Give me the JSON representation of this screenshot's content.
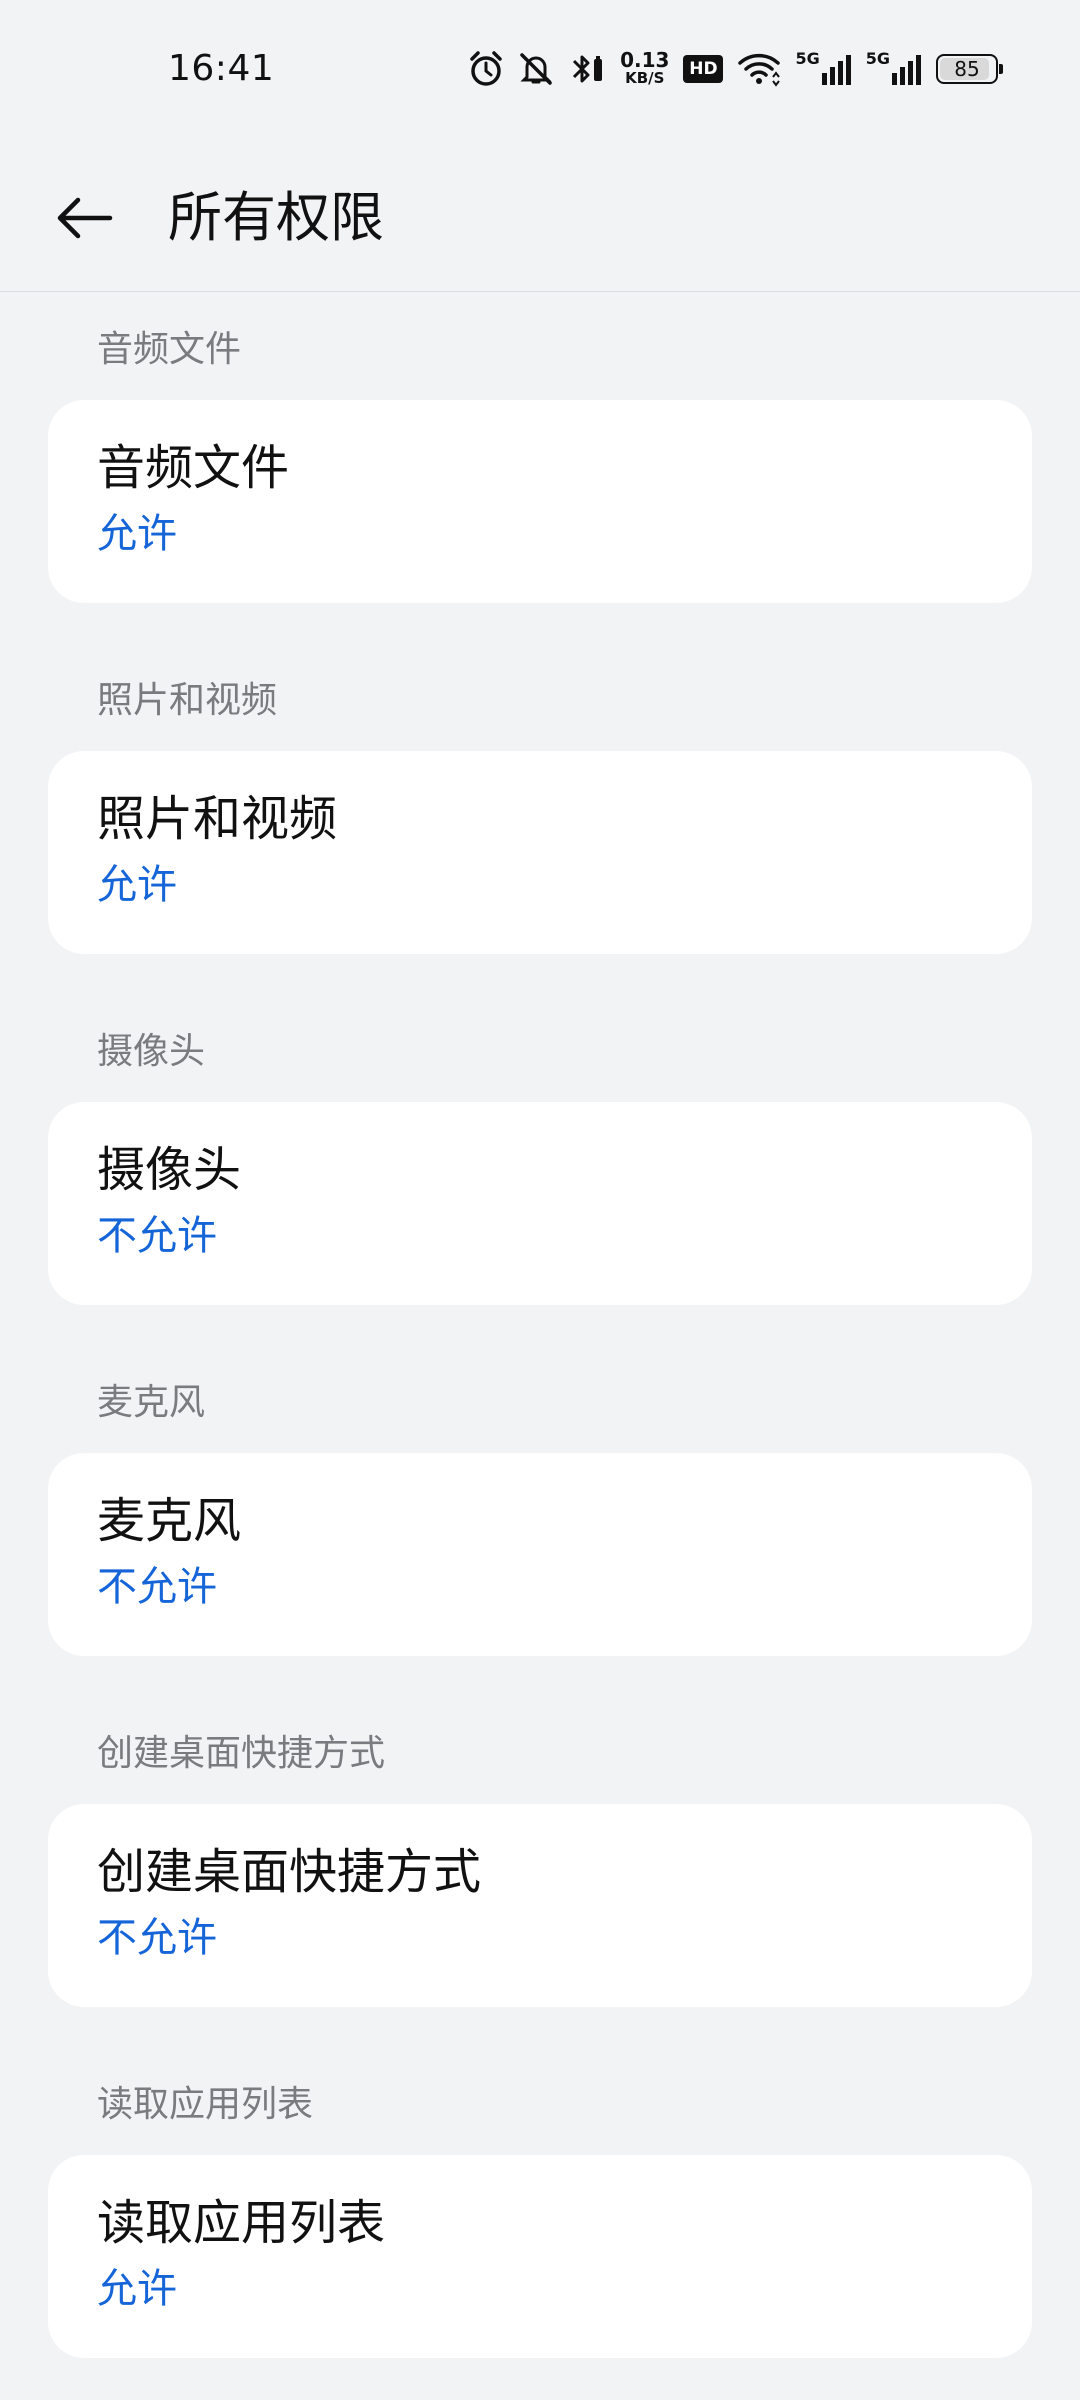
{
  "status_bar": {
    "time": "16:41",
    "net_speed_value": "0.13",
    "net_speed_unit": "KB/S",
    "hd_label": "HD",
    "network_1": "5G",
    "network_2": "5G",
    "battery_level": "85",
    "icons": [
      "alarm-icon",
      "mute-bell-icon",
      "bluetooth-icon",
      "hd-voice-icon",
      "wifi-icon",
      "signal-icon",
      "signal-icon",
      "battery-icon"
    ]
  },
  "app_bar": {
    "title": "所有权限",
    "back_icon": "back-arrow-icon"
  },
  "groups": [
    {
      "header": "音频文件",
      "title": "音频文件",
      "status": "允许"
    },
    {
      "header": "照片和视频",
      "title": "照片和视频",
      "status": "允许"
    },
    {
      "header": "摄像头",
      "title": "摄像头",
      "status": "不允许"
    },
    {
      "header": "麦克风",
      "title": "麦克风",
      "status": "不允许"
    },
    {
      "header": "创建桌面快捷方式",
      "title": "创建桌面快捷方式",
      "status": "不允许"
    },
    {
      "header": "读取应用列表",
      "title": "读取应用列表",
      "status": "允许"
    }
  ],
  "colors": {
    "background": "#f2f3f5",
    "card": "#ffffff",
    "accent": "#1565d8",
    "section_header": "#7a7b7e"
  }
}
